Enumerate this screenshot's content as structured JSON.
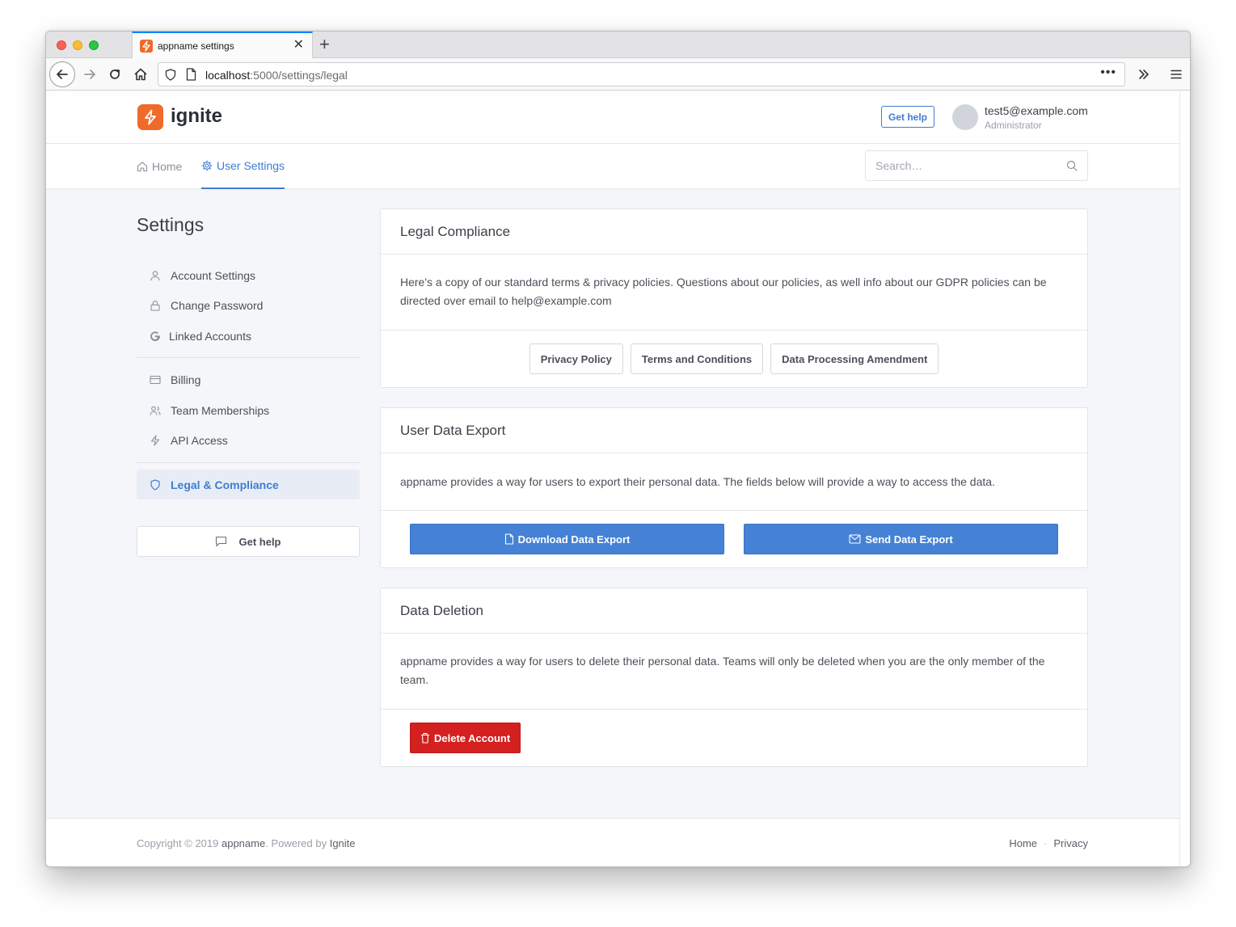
{
  "browser": {
    "tab_title": "appname settings",
    "url_host": "localhost",
    "url_rest": ":5000/settings/legal",
    "url_more": "•••"
  },
  "header": {
    "logo_text": "ignite",
    "help_label": "Get help",
    "user_email": "test5@example.com",
    "user_role": "Administrator"
  },
  "subnav": {
    "home_label": "Home",
    "settings_label": "User Settings",
    "search_placeholder": "Search…"
  },
  "sidebar": {
    "title": "Settings",
    "items": [
      {
        "label": "Account Settings",
        "icon": "user-icon"
      },
      {
        "label": "Change Password",
        "icon": "lock-icon"
      },
      {
        "label": "Linked Accounts",
        "icon": "google-icon"
      },
      {
        "label": "Billing",
        "icon": "credit-card-icon"
      },
      {
        "label": "Team Memberships",
        "icon": "users-icon"
      },
      {
        "label": "API Access",
        "icon": "zap-icon"
      },
      {
        "label": "Legal & Compliance",
        "icon": "shield-icon",
        "active": true
      }
    ],
    "help_label": "Get help"
  },
  "legal_card": {
    "title": "Legal Compliance",
    "body": "Here's a copy of our standard terms & privacy policies. Questions about our policies, as well info about our GDPR policies can be directed over email to help@example.com",
    "buttons": [
      "Privacy Policy",
      "Terms and Conditions",
      "Data Processing Amendment"
    ]
  },
  "export_card": {
    "title": "User Data Export",
    "body": "appname provides a way for users to export their personal data. The fields below will provide a way to access the data.",
    "download_label": "Download Data Export",
    "send_label": "Send Data Export"
  },
  "deletion_card": {
    "title": "Data Deletion",
    "body": "appname provides a way for users to delete their personal data. Teams will only be deleted when you are the only member of the team.",
    "delete_label": "Delete Account"
  },
  "footer": {
    "copyright": "Copyright © 2019 ",
    "app_name": "appname",
    "powered_by": ". Powered by ",
    "brand": "Ignite",
    "links": [
      "Home",
      "Privacy"
    ],
    "separator": "·"
  },
  "colors": {
    "accent": "#3e7dd1",
    "primary_button": "#4582d6",
    "danger_button": "#d52020",
    "brand_orange": "#f06a2a"
  }
}
